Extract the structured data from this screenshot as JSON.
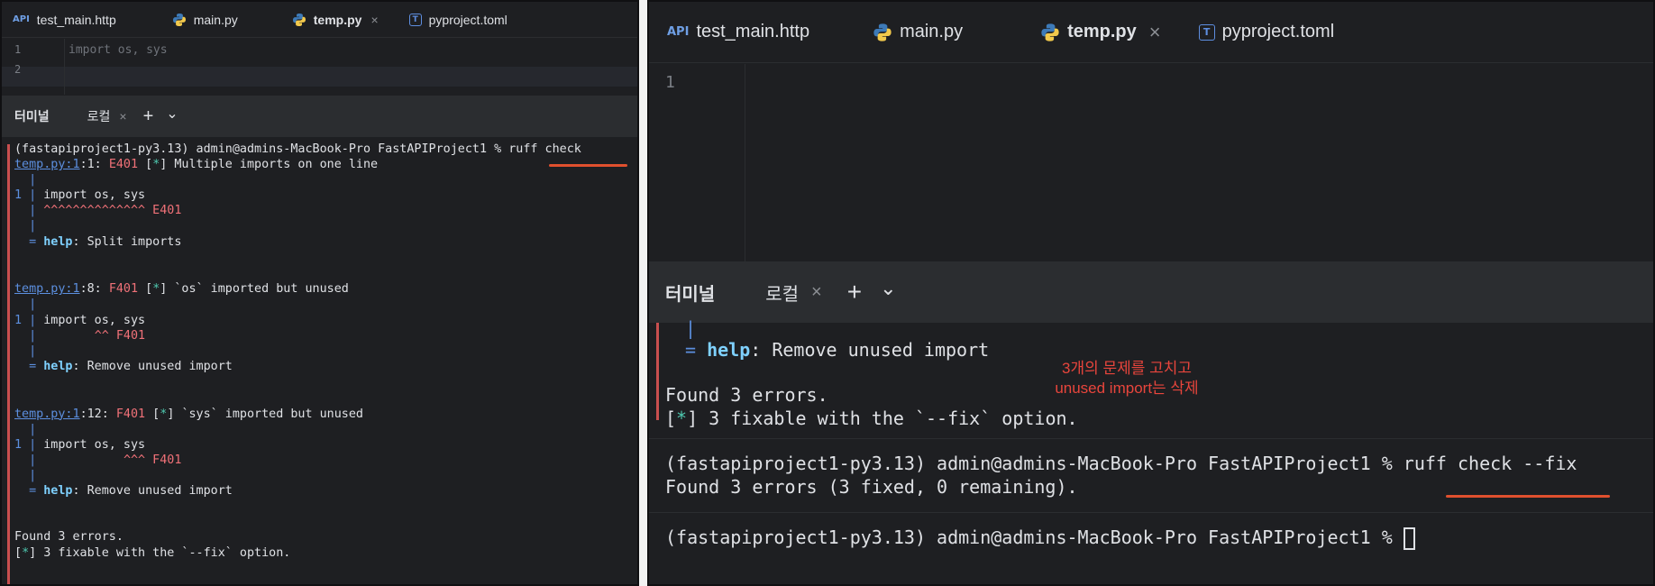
{
  "left": {
    "tabs": [
      {
        "icon": "api-icon",
        "glyph": "API",
        "label": "test_main.http"
      },
      {
        "icon": "python-icon",
        "label": "main.py"
      },
      {
        "icon": "python-icon",
        "label": "temp.py",
        "active": true,
        "close": "×"
      },
      {
        "icon": "toml-icon",
        "glyph": "T",
        "label": "pyproject.toml"
      }
    ],
    "editor": {
      "line_numbers": [
        "1",
        "2"
      ],
      "code": "import os, sys"
    },
    "terminal": {
      "title": "터미널",
      "tab_label": "로컬",
      "close": "×",
      "add": "+",
      "menu": "⌄",
      "prompt": "(fastapiproject1-py3.13) admin@admins-MacBook-Pro FastAPIProject1 % ",
      "command": "ruff check",
      "diagnostics": [
        {
          "file": "temp.py:1",
          "pos": ":1: ",
          "code": "E401",
          "fix": "[*]",
          "message": "Multiple imports on one line",
          "pipe": "|",
          "line_no": "1",
          "source": "import os, sys",
          "marker_indent": "",
          "marker": "^^^^^^^^^^^^^^ E401",
          "help_label": "help",
          "help_text": ": Split imports"
        },
        {
          "file": "temp.py:1",
          "pos": ":8: ",
          "code": "F401",
          "fix": "[*]",
          "message": "`os` imported but unused",
          "pipe": "|",
          "line_no": "1",
          "source": "import os, sys",
          "marker_indent": "       ",
          "marker": "^^ F401",
          "help_label": "help",
          "help_text": ": Remove unused import"
        },
        {
          "file": "temp.py:1",
          "pos": ":12: ",
          "code": "F401",
          "fix": "[*]",
          "message": "`sys` imported but unused",
          "pipe": "|",
          "line_no": "1",
          "source": "import os, sys",
          "marker_indent": "           ",
          "marker": "^^^ F401",
          "help_label": "help",
          "help_text": ": Remove unused import"
        }
      ],
      "found": "Found 3 errors.",
      "fixable_mark": "*",
      "fixable_rest": " 3 fixable with the `--fix` option."
    }
  },
  "right": {
    "tabs": [
      {
        "icon": "api-icon",
        "glyph": "API",
        "label": "test_main.http"
      },
      {
        "icon": "python-icon",
        "label": "main.py"
      },
      {
        "icon": "python-icon",
        "label": "temp.py",
        "active": true,
        "close": "×"
      },
      {
        "icon": "toml-icon",
        "glyph": "T",
        "label": "pyproject.toml"
      }
    ],
    "editor": {
      "line_numbers": [
        "1"
      ]
    },
    "terminal": {
      "title": "터미널",
      "tab_label": "로컬",
      "close": "×",
      "add": "+",
      "menu": "⌄",
      "pipe": "|",
      "help_label": "help",
      "help_text": ": Remove unused import",
      "found": "Found 3 errors.",
      "fixable_mark": "*",
      "fixable_rest": " 3 fixable with the `--fix` option.",
      "prompt": "(fastapiproject1-py3.13) admin@admins-MacBook-Pro FastAPIProject1 % ",
      "command": "ruff check --fix",
      "result": "Found 3 errors (3 fixed, 0 remaining).",
      "prompt2": "(fastapiproject1-py3.13) admin@admins-MacBook-Pro FastAPIProject1 % "
    },
    "annotation": [
      "3개의 문제를 고치고",
      "unused import는 삭제"
    ]
  },
  "colors": {
    "background": "#1e1f22",
    "error_code": "#f07178",
    "link": "#5c8fdf",
    "annotation": "#e8453c",
    "underline": "#e0502e"
  }
}
